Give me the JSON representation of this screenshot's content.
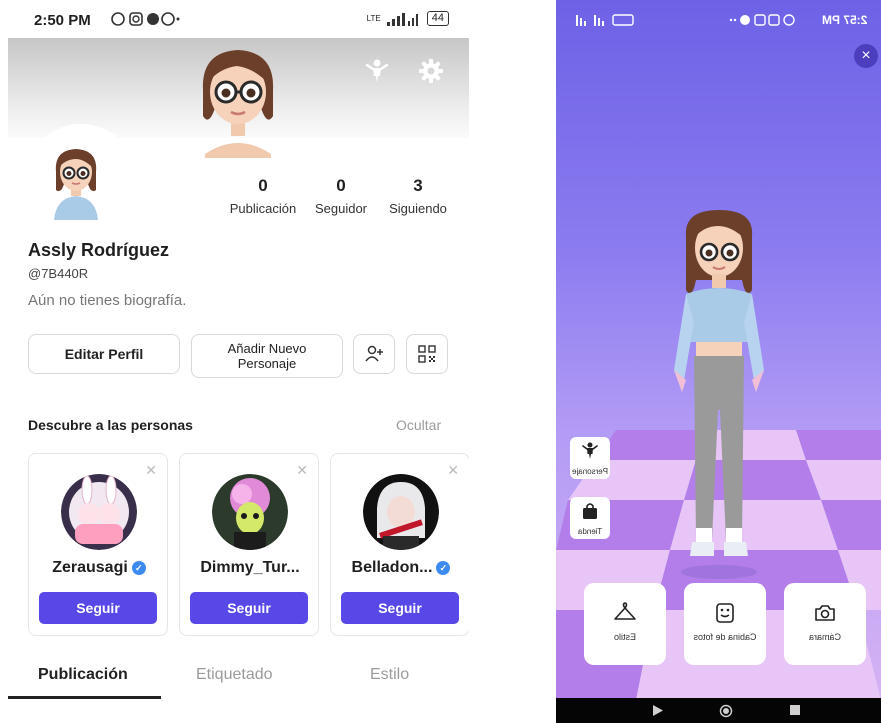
{
  "left_screen": {
    "status": {
      "time": "2:50 PM",
      "network": "LTE",
      "battery": "44"
    },
    "stats": [
      {
        "value": "0",
        "label": "Publicación"
      },
      {
        "value": "0",
        "label": "Seguidor"
      },
      {
        "value": "3",
        "label": "Siguiendo"
      }
    ],
    "profile": {
      "name": "Assly Rodríguez",
      "handle": "@7B440R",
      "bio": "Aún no tienes biografía."
    },
    "actions": {
      "edit_label": "Editar Perfil",
      "add_character_label_line1": "Añadir Nuevo",
      "add_character_label_line2": "Personaje"
    },
    "discover": {
      "title": "Descubre a las personas",
      "hide_label": "Ocultar",
      "close_glyph": "✕",
      "cards": [
        {
          "username": "Zerausagi",
          "verified": true,
          "follow_label": "Seguir"
        },
        {
          "username": "Dimmy_Tur...",
          "verified": false,
          "follow_label": "Seguir"
        },
        {
          "username": "Belladon...",
          "verified": true,
          "follow_label": "Seguir"
        }
      ]
    },
    "tabs": [
      {
        "label": "Publicación",
        "active": true
      },
      {
        "label": "Etiquetado",
        "active": false
      },
      {
        "label": "Estilo",
        "active": false
      }
    ],
    "colors": {
      "follow_button": "#5848e8",
      "verified_badge": "#3d8bf2"
    }
  },
  "right_screen": {
    "status": {
      "time": "2:57 PM"
    },
    "close_glyph": "×",
    "side_buttons": [
      {
        "label": "Personaje",
        "icon": "figure-icon"
      },
      {
        "label": "Tienda",
        "icon": "shopping-bag-icon"
      }
    ],
    "bottom_buttons": [
      {
        "label": "Estilo",
        "icon": "hanger-icon"
      },
      {
        "label": "Cabina de fotos",
        "icon": "photo-booth-icon"
      },
      {
        "label": "Cámara",
        "icon": "camera-icon"
      }
    ],
    "colors": {
      "background_top": "#6d62e6",
      "background_bottom": "#d9b4f4",
      "floor_light": "#e7c6f7",
      "floor_dark": "#b37ee9"
    }
  }
}
